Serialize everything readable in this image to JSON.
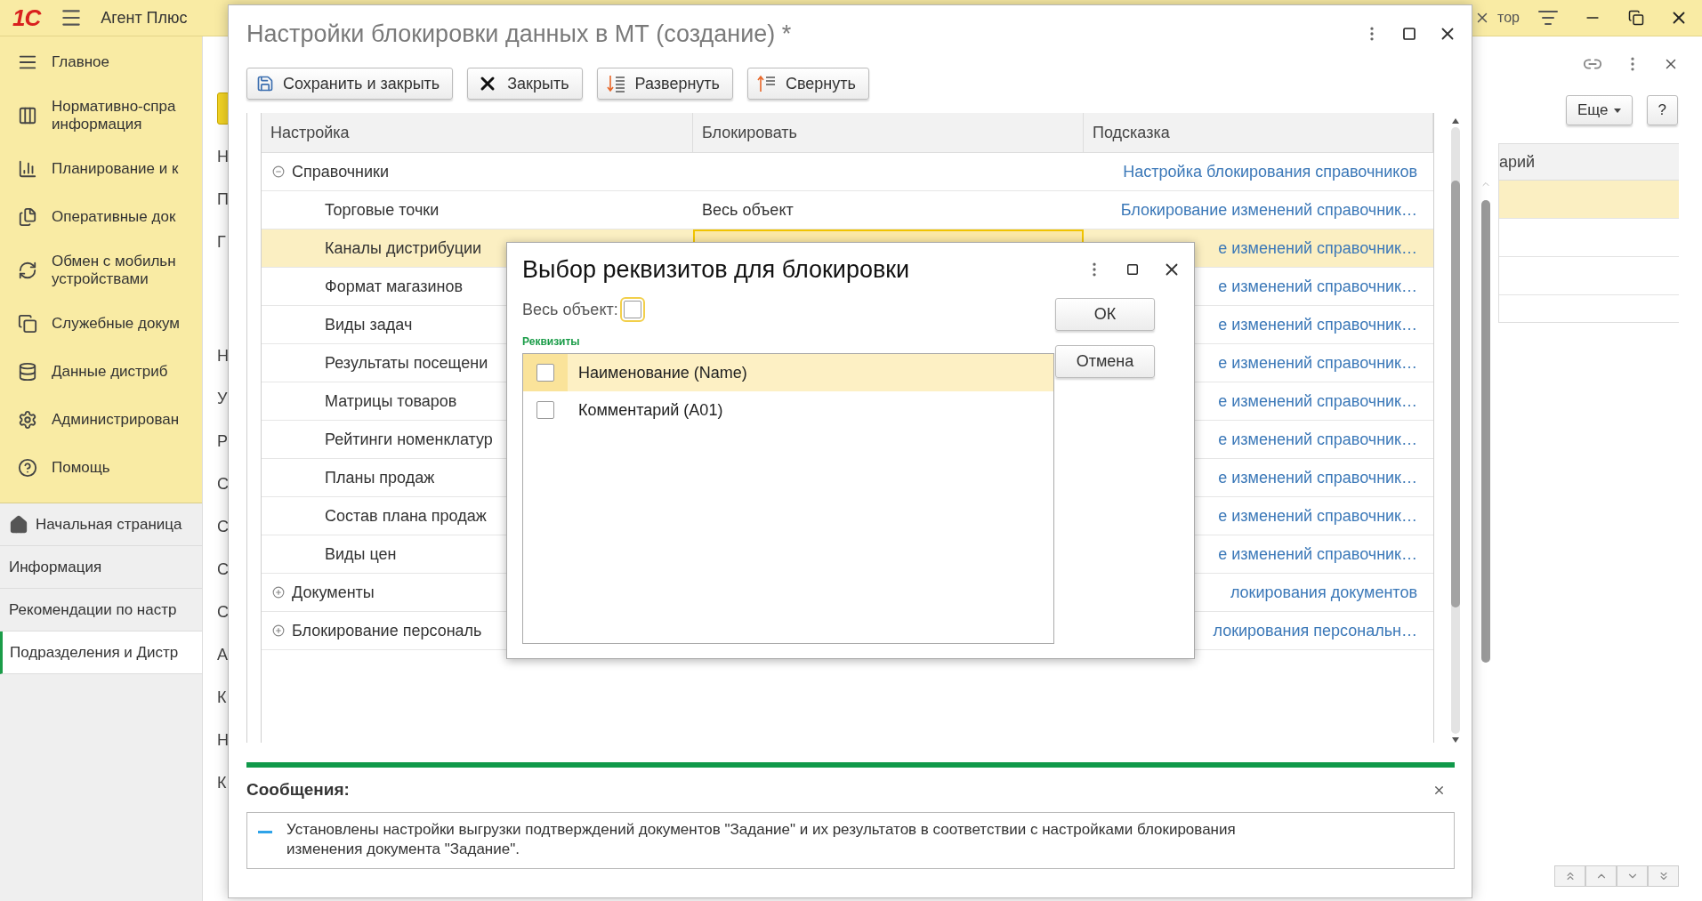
{
  "top_bar": {
    "logo": "1С",
    "app_title": "Агент Плюс",
    "user_fragment": "тор"
  },
  "sidebar": {
    "sections": [
      {
        "label": "Главное",
        "kind": "main",
        "selected": false
      },
      {
        "label": "Нормативно-спра\nинформация",
        "kind": "catalog",
        "selected": false
      },
      {
        "label": "Планирование и к",
        "kind": "chart",
        "selected": false
      },
      {
        "label": "Оперативные док",
        "kind": "docs",
        "selected": false
      },
      {
        "label": "Обмен с мобильн\nустройствами",
        "kind": "sync",
        "selected": false
      },
      {
        "label": "Служебные докум",
        "kind": "service",
        "selected": false
      },
      {
        "label": "Данные дистриб",
        "kind": "data",
        "selected": false
      },
      {
        "label": "Администрирован",
        "kind": "admin",
        "selected": false
      },
      {
        "label": "Помощь",
        "kind": "help",
        "selected": false
      }
    ],
    "open_tabs": [
      {
        "label": "Начальная страница",
        "kind": "home",
        "selected": false
      },
      {
        "label": "Информация",
        "kind": "page",
        "selected": false
      },
      {
        "label": "Рекомендации по настр",
        "kind": "page",
        "selected": false
      },
      {
        "label": "Подразделения и Дистр",
        "kind": "page",
        "selected": true
      }
    ]
  },
  "background_form": {
    "groups": [
      [
        "Н",
        "П",
        "Г"
      ],
      [
        "Н",
        "У",
        "Р",
        "С",
        "С",
        "С",
        "С",
        "А",
        "К",
        "Н",
        "К"
      ]
    ]
  },
  "right_panel": {
    "more_button": "Еще",
    "help_button": "?",
    "table": {
      "column": "арий",
      "rows": [
        {
          "selected": true
        },
        {
          "selected": false
        },
        {
          "selected": false
        }
      ]
    }
  },
  "dialog": {
    "title": "Настройки блокировки данных в МТ (создание) *",
    "buttons": [
      {
        "label": "Сохранить и закрыть",
        "kind": "save"
      },
      {
        "label": "Закрыть",
        "kind": "close"
      },
      {
        "label": "Развернуть",
        "kind": "expand"
      },
      {
        "label": "Свернуть",
        "kind": "collapse"
      }
    ],
    "table": {
      "columns": [
        "Настройка",
        "Блокировать",
        "Подсказка"
      ],
      "rows": [
        {
          "setting": "Справочники",
          "expanded": true,
          "selected": false,
          "hint": "Настройка блокирования справочников",
          "children": [
            {
              "setting": "Торговые точки",
              "block": "Весь объект",
              "selected": false,
              "hint": "Блокирование изменений справочник…"
            },
            {
              "setting": "Каналы дистрибуции",
              "selected": true,
              "hint": "е изменений справочник…"
            },
            {
              "setting": "Формат магазинов",
              "selected": false,
              "hint": "е изменений справочник…"
            },
            {
              "setting": "Виды задач",
              "selected": false,
              "hint": "е изменений справочник…"
            },
            {
              "setting": "Результаты посещени",
              "selected": false,
              "hint": "е изменений справочник…"
            },
            {
              "setting": "Матрицы товаров",
              "selected": false,
              "hint": "е изменений справочник…"
            },
            {
              "setting": "Рейтинги номенклатур",
              "selected": false,
              "hint": "е изменений справочник…"
            },
            {
              "setting": "Планы продаж",
              "selected": false,
              "hint": "е изменений справочник…"
            },
            {
              "setting": "Состав плана продаж",
              "selected": false,
              "hint": "е изменений справочник…"
            },
            {
              "setting": "Виды цен",
              "selected": false,
              "hint": "е изменений справочник…"
            }
          ]
        },
        {
          "setting": "Документы",
          "expanded": false,
          "selected": false,
          "hint": "локирования документов"
        },
        {
          "setting": "Блокирование персональ",
          "expanded": false,
          "selected": false,
          "hint": "локирования персональн…"
        }
      ]
    },
    "messages": {
      "title": "Сообщения:",
      "items": [
        "Установлены настройки выгрузки подтверждений документов \"Задание\" и их результатов в соответствии с настройками блокирования изменения документа \"Задание\"."
      ]
    }
  },
  "popup": {
    "title": "Выбор реквизитов для блокировки",
    "whole_object": {
      "label": "Весь объект:",
      "checked": false
    },
    "group_label": "Реквизиты",
    "attributes": [
      {
        "label": "Наименование (Name)",
        "checked": false,
        "selected": true
      },
      {
        "label": "Комментарий (A01)",
        "checked": false,
        "selected": false
      }
    ],
    "buttons": [
      "ОК",
      "Отмена"
    ]
  }
}
